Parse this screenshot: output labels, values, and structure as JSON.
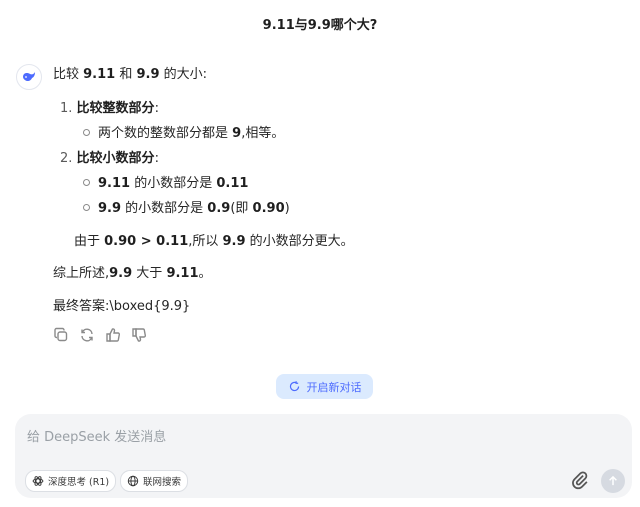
{
  "header": {
    "title": "9.11与9.9哪个大?"
  },
  "answer": {
    "intro": {
      "pre": "比较 ",
      "a": "9.11",
      "mid": " 和 ",
      "b": "9.9",
      "post": " 的大小:"
    },
    "step1": {
      "num": "1.",
      "heading": "比较整数部分",
      "colon": ":",
      "bullet1": {
        "pre": "两个数的整数部分都是 ",
        "val": "9",
        "post": ",相等。"
      }
    },
    "step2": {
      "num": "2.",
      "heading": "比较小数部分",
      "colon": ":",
      "bullet1": {
        "a": "9.11",
        "mid": " 的小数部分是 ",
        "b": "0.11"
      },
      "bullet2": {
        "a": "9.9",
        "mid": " 的小数部分是 ",
        "b": "0.9",
        "open": "(即 ",
        "c": "0.90",
        "close": ")"
      }
    },
    "conclusion_step": {
      "pre": "由于 ",
      "ineq": "0.90 > 0.11",
      "mid": ",所以 ",
      "val": "9.9",
      "post": " 的小数部分更大。"
    },
    "summary": {
      "pre": "综上所述,",
      "a": "9.9",
      "mid": " 大于 ",
      "b": "9.11",
      "post": "。"
    },
    "final": "最终答案:\\boxed{9.9}"
  },
  "actions": [
    "copy-icon",
    "regenerate-icon",
    "thumbs-up-icon",
    "thumbs-down-icon"
  ],
  "new_chat": {
    "label": "开启新对话",
    "icon": "new-chat-icon"
  },
  "composer": {
    "placeholder": "给 DeepSeek 发送消息",
    "deep_think_label": "深度思考 (R1)",
    "web_search_label": "联网搜索"
  },
  "colors": {
    "accent": "#4d6bfe",
    "new_chat_bg": "#dbeafe",
    "composer_bg": "#f3f4f6"
  }
}
